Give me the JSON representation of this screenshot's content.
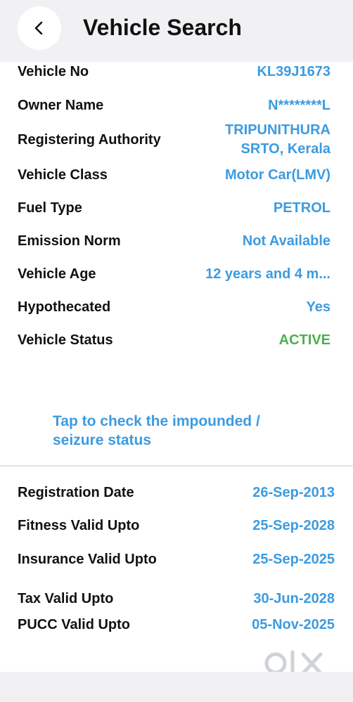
{
  "header": {
    "title": "Vehicle Search",
    "back_icon": "chevron-left-icon"
  },
  "vehicle": {
    "vehicle_no": {
      "label": "Vehicle No",
      "value": "KL39J1673"
    },
    "owner_name": {
      "label": "Owner Name",
      "value": "N********L"
    },
    "registering_authority": {
      "label": "Registering Authority",
      "value_line1": "TRIPUNITHURA",
      "value_line2": "SRTO, Kerala"
    },
    "vehicle_class": {
      "label": "Vehicle Class",
      "value": "Motor Car(LMV)"
    },
    "fuel_type": {
      "label": "Fuel Type",
      "value": "PETROL"
    },
    "emission_norm": {
      "label": "Emission Norm",
      "value": "Not Available"
    },
    "vehicle_age": {
      "label": "Vehicle Age",
      "value": "12 years and 4 m..."
    },
    "hypothecated": {
      "label": "Hypothecated",
      "value": "Yes"
    },
    "vehicle_status": {
      "label": "Vehicle Status",
      "value": "ACTIVE"
    }
  },
  "impound_link": {
    "line1": "Tap to check the impounded /",
    "line2": "seizure status"
  },
  "validity": {
    "registration_date": {
      "label": "Registration Date",
      "value": "26-Sep-2013"
    },
    "fitness": {
      "label": "Fitness Valid Upto",
      "value": "25-Sep-2028"
    },
    "insurance": {
      "label": "Insurance Valid Upto",
      "value": "25-Sep-2025"
    },
    "tax": {
      "label": "Tax Valid Upto",
      "value": "30-Jun-2028"
    },
    "pucc": {
      "label": "PUCC Valid Upto",
      "value": "05-Nov-2025"
    }
  },
  "watermark": {
    "text": "OLX"
  },
  "colors": {
    "accent": "#3c9be0",
    "status_active": "#4caf50",
    "header_bg": "#f1f1f3"
  }
}
